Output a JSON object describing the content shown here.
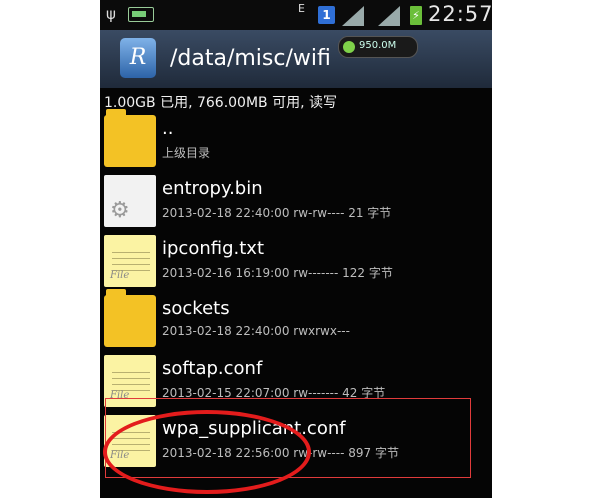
{
  "status_bar": {
    "usb_icon": "usb-icon",
    "battery_small_icon": "battery-small-icon",
    "network_type": "E",
    "sim_label": "1",
    "battery_level": "⚡",
    "time": "22:57"
  },
  "header": {
    "app_icon_letter": "R",
    "path": "/data/misc/wifi",
    "memory_label": "950.0M"
  },
  "storage_info": "1.00GB 已用, 766.00MB 可用, 读写",
  "files": [
    {
      "name": "..",
      "meta": "上级目录",
      "icon": "folder-icon"
    },
    {
      "name": "entropy.bin",
      "meta": "2013-02-18 22:40:00  rw-rw----  21 字节",
      "icon": "gear-icon"
    },
    {
      "name": "ipconfig.txt",
      "meta": "2013-02-16 16:19:00  rw-------  122 字节",
      "icon": "note-icon"
    },
    {
      "name": "sockets",
      "meta": "2013-02-18 22:40:00  rwxrwx---",
      "icon": "folder-icon"
    },
    {
      "name": "softap.conf",
      "meta": "2013-02-15 22:07:00  rw-------  42 字节",
      "icon": "note-icon"
    },
    {
      "name": "wpa_supplicant.conf",
      "meta": "2013-02-18 22:56:00  rw-rw----  897 字节",
      "icon": "note-icon"
    }
  ],
  "file_icon_label": "File",
  "colors": {
    "highlight_box": "#e03b3b",
    "highlight_circle": "#e31c1c",
    "folder": "#f3c225",
    "note": "#fbf3a3"
  }
}
